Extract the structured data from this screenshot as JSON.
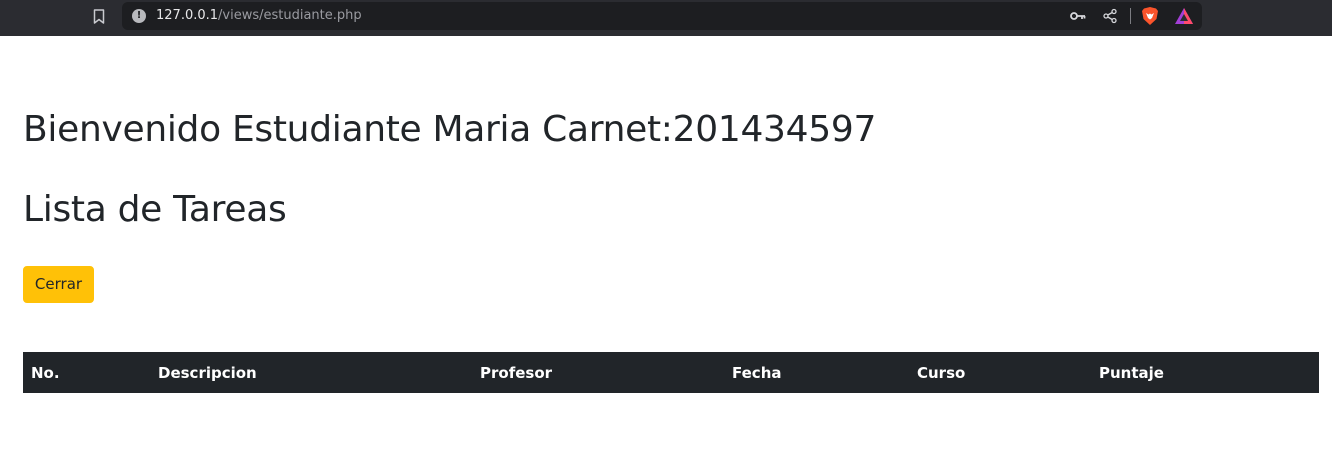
{
  "browser": {
    "url_host": "127.0.0.1",
    "url_path": "/views/estudiante.php",
    "icons": [
      "bookmark-icon",
      "info-icon",
      "key-icon",
      "share-icon",
      "brave-shield-icon",
      "brave-rewards-icon"
    ]
  },
  "page": {
    "title": "Bienvenido Estudiante Maria Carnet:201434597",
    "section_title": "Lista de Tareas",
    "logout_label": "Cerrar"
  },
  "table": {
    "columns": [
      "No.",
      "Descripcion",
      "Profesor",
      "Fecha",
      "Curso",
      "Puntaje"
    ]
  },
  "colors": {
    "warning_button": "#ffc107",
    "table_header": "#212529",
    "text": "#212529"
  }
}
